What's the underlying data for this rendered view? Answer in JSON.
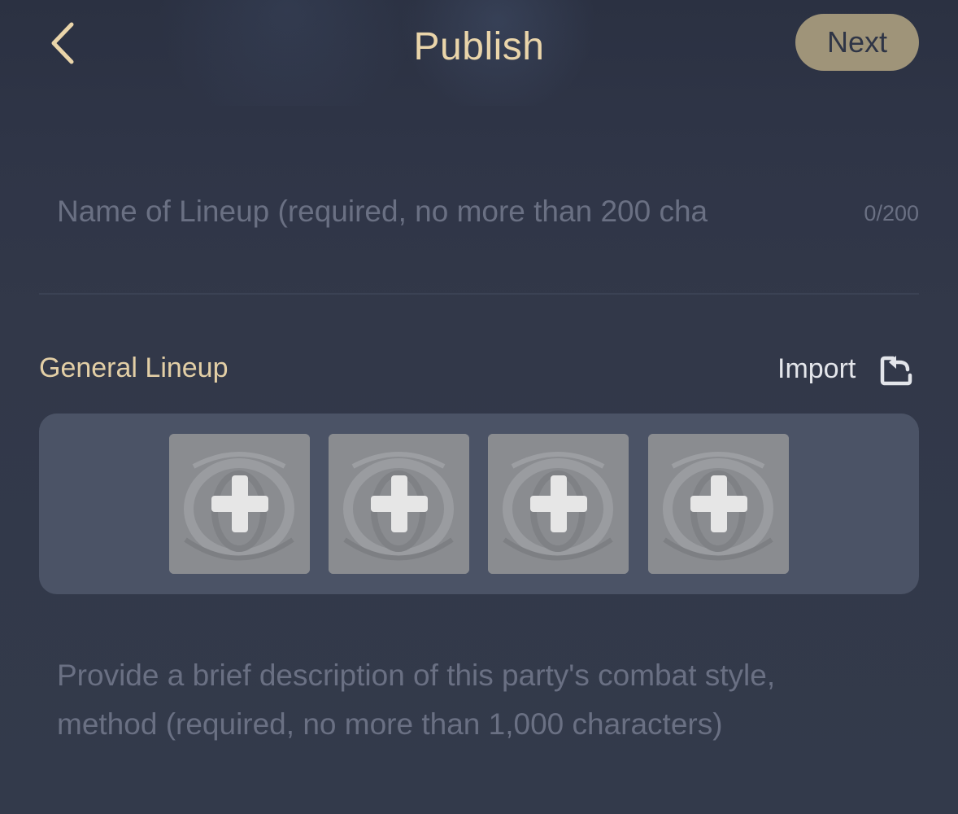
{
  "header": {
    "title": "Publish",
    "next_label": "Next",
    "back_icon": "chevron-left-icon"
  },
  "lineup_name": {
    "placeholder": "Name of Lineup (required, no more than 200 cha",
    "value": "",
    "counter": "0/200"
  },
  "lineup": {
    "section_title": "General Lineup",
    "import_label": "Import",
    "import_icon": "import-share-icon",
    "slots": [
      {
        "state": "empty",
        "icon": "plus-icon"
      },
      {
        "state": "empty",
        "icon": "plus-icon"
      },
      {
        "state": "empty",
        "icon": "plus-icon"
      },
      {
        "state": "empty",
        "icon": "plus-icon"
      }
    ]
  },
  "description": {
    "placeholder": "Provide a brief description of this party's combat style, method (required, no more than 1,000 characters)"
  },
  "colors": {
    "accent_gold": "#ead5aa",
    "next_button_bg": "#9f9479",
    "panel_bg": "#4b5366",
    "page_bg": "#323849",
    "placeholder_text": "#6a7083"
  }
}
